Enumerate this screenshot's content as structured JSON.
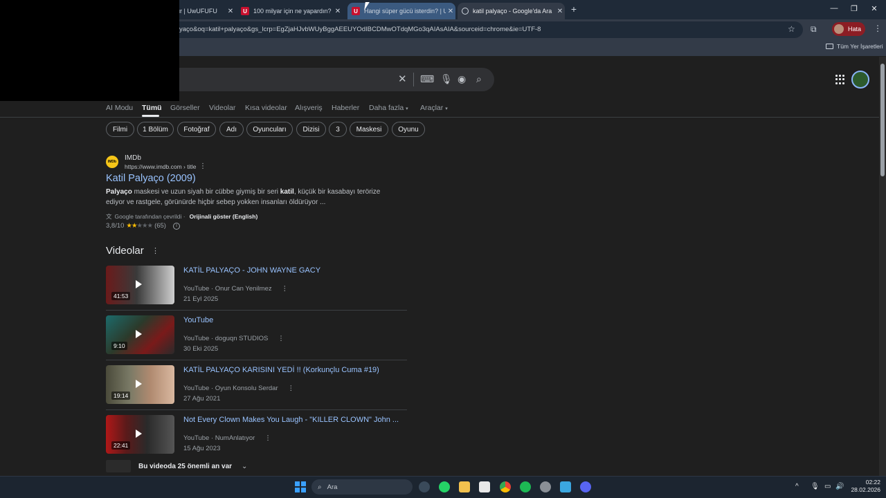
{
  "tabs": [
    {
      "title": "ur | UwUFUFU",
      "favicon": "none"
    },
    {
      "title": "100 milyar için ne yapardın? | U",
      "favicon": "U"
    },
    {
      "title": "Hangi süper gücü isterdin? | Uw",
      "favicon": "U"
    },
    {
      "title": "katil palyaço - Google'da Ara",
      "favicon": "google-g-icon"
    }
  ],
  "address_bar": {
    "url": "yaço&oq=katil+palyaço&gs_lcrp=EgZjaHJvbWUyBggAEEUYOdIBCDMwOTdqMGo3qAIAsAIA&sourceid=chrome&ie=UTF-8"
  },
  "profile": {
    "label": "Hata",
    "color": "#8c1d24"
  },
  "bookmarks": {
    "all_label": "Tüm Yer İşaretleri"
  },
  "nav_tabs": [
    "AI Modu",
    "Tümü",
    "Görseller",
    "Videolar",
    "Kısa videolar",
    "Alışveriş",
    "Haberler",
    "Daha fazla",
    "Araçlar"
  ],
  "chips": [
    "Filmi",
    "1 Bölüm",
    "Fotoğraf",
    "Adı",
    "Oyuncuları",
    "Dizisi",
    "3",
    "Maskesi",
    "Oyunu"
  ],
  "result": {
    "logo_text": "IMDb",
    "site_name": "IMDb",
    "site_url": "https://www.imdb.com › title",
    "title": "Katil Palyaço (2009)",
    "snippet_b1": "Palyaço",
    "snippet_t1": " maskesi ve uzun siyah bir cübbe giymiş bir seri ",
    "snippet_b2": "katil",
    "snippet_t2": ", küçük bir kasabayı terörize ediyor ve rastgele, görünürde hiçbir sebep yokken insanları öldürüyor ...",
    "translated_label": "Google tarafından çevrildi ·",
    "show_original": "Orijinali göster (English)",
    "rating": "3,8/10",
    "rating_count": "(65)",
    "stars_filled": 2,
    "stars_total": 5
  },
  "videos": {
    "heading": "Videolar",
    "items": [
      {
        "title": "KATİL PALYAÇO - JOHN WAYNE GACY",
        "source": "YouTube · Onur Can Yenilmez",
        "date": "21 Eyl 2025",
        "duration": "41:53"
      },
      {
        "title": "YouTube",
        "source": "YouTube · doguqn STUDIOS",
        "date": "30 Eki 2025",
        "duration": "9:10"
      },
      {
        "title": "KATİL PALYAÇO KARISINI YEDİ !! (Korkunçlu Cuma #19)",
        "source": "YouTube · Oyun Konsolu Serdar",
        "date": "27 Ağu 2021",
        "duration": "19:14"
      },
      {
        "title": "Not Every Clown Makes You Laugh - \"KILLER CLOWN\" John ...",
        "source": "YouTube · NumAnlatıyor",
        "date": "15 Ağu 2023",
        "duration": "22:41"
      }
    ],
    "key_moments": "Bu videoda 25 önemli an var"
  },
  "taskbar": {
    "search_placeholder": "Ara",
    "time": "02:22",
    "date": "28.02.2026"
  }
}
